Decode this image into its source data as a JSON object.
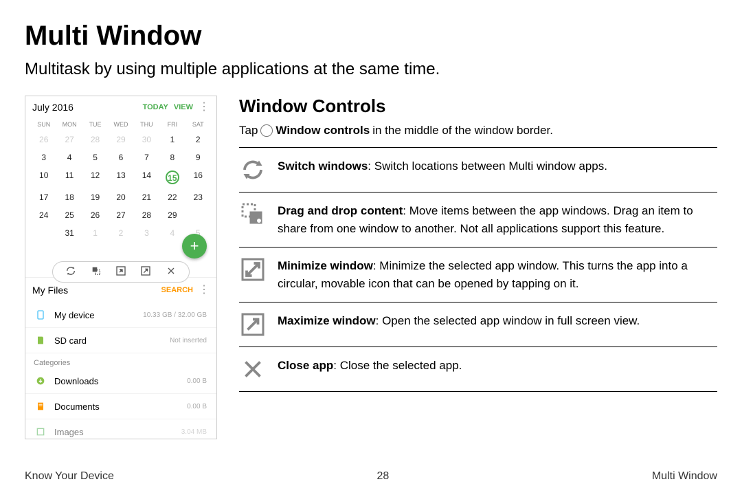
{
  "title": "Multi Window",
  "subtitle": "Multitask by using multiple applications at the same time.",
  "calendar": {
    "month": "July 2016",
    "today": "TODAY",
    "view": "VIEW",
    "dow": [
      "SUN",
      "MON",
      "TUE",
      "WED",
      "THU",
      "FRI",
      "SAT"
    ]
  },
  "files": {
    "title": "My Files",
    "search": "SEARCH",
    "rows": [
      {
        "name": "My device",
        "meta": "10.33 GB / 32.00 GB"
      },
      {
        "name": "SD card",
        "meta": "Not inserted"
      }
    ],
    "categories_label": "Categories",
    "cats": [
      {
        "name": "Downloads",
        "meta": "0.00 B"
      },
      {
        "name": "Documents",
        "meta": "0.00 B"
      },
      {
        "name": "Images",
        "meta": "3.04 MB"
      }
    ]
  },
  "section": {
    "title": "Window Controls",
    "tap_prefix": "Tap",
    "tap_bold": "Window controls",
    "tap_suffix": "in the middle of the window border."
  },
  "items": [
    {
      "bold": "Switch windows",
      "rest": ": Switch locations between Multi window apps."
    },
    {
      "bold": "Drag and drop content",
      "rest": ": Move items between the app windows. Drag an item to share from one window to another. Not all applications support this feature."
    },
    {
      "bold": "Minimize window",
      "rest": ": Minimize the selected app window. This turns the app into a circular, movable icon that can be opened by tapping on it."
    },
    {
      "bold": "Maximize window",
      "rest": ": Open the selected app window in full screen view."
    },
    {
      "bold": "Close app",
      "rest": ": Close the selected app."
    }
  ],
  "footer": {
    "left": "Know Your Device",
    "center": "28",
    "right": "Multi Window"
  }
}
